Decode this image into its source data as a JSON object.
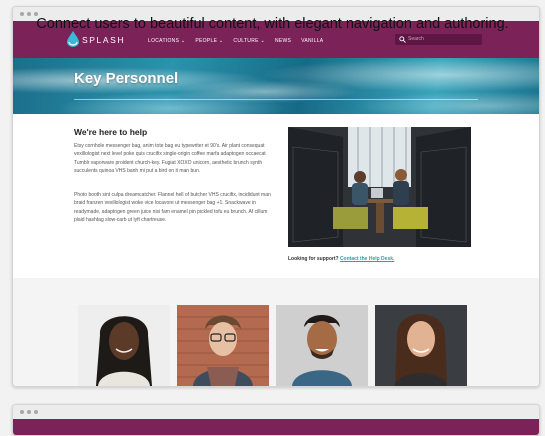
{
  "headline": "Connect users to beautiful content, with elegant navigation and authoring.",
  "brand": {
    "name": "SPLASH",
    "color": "#7b2258",
    "accent": "#2c9db8"
  },
  "nav": {
    "items": [
      {
        "label": "LOCATIONS ⌄"
      },
      {
        "label": "PEOPLE ⌄"
      },
      {
        "label": "CULTURE ⌄"
      },
      {
        "label": "NEWS"
      },
      {
        "label": "VANILLA"
      }
    ],
    "search_placeholder": "Search"
  },
  "hero": {
    "title": "Key Personnel"
  },
  "main": {
    "heading": "We're here to help",
    "paragraph1": "Etsy cornhole messenger bag, anim tote bag eu typewriter et 90's. Air plant consequat vexillologist next level poke quis crucifix single-origin coffee marfa adaptogen occaecat Tumblr vaporware proident church-key. Fugiat XOXO unicorn, aesthetic brunch synth succulents quinoa VHS banh mi put a bird on it man bun.",
    "paragraph2": "Photo booth sint culpa dreamcatcher. Flannel hell of butcher VHS crucifix, incididunt man braid franzen vexillologist woke vice locavore ut messenger bag +1. Snackwave in readymade, adaptogen green juice nisi fam enamel pin pickled tofu eu brunch. Af cillum plaid hashtag slow-carb ut lyft chartreuse.",
    "support_text": "Looking for support?",
    "support_link": "Contact the Help Desk."
  },
  "icons": [
    "splash-logo-icon",
    "search-icon"
  ]
}
